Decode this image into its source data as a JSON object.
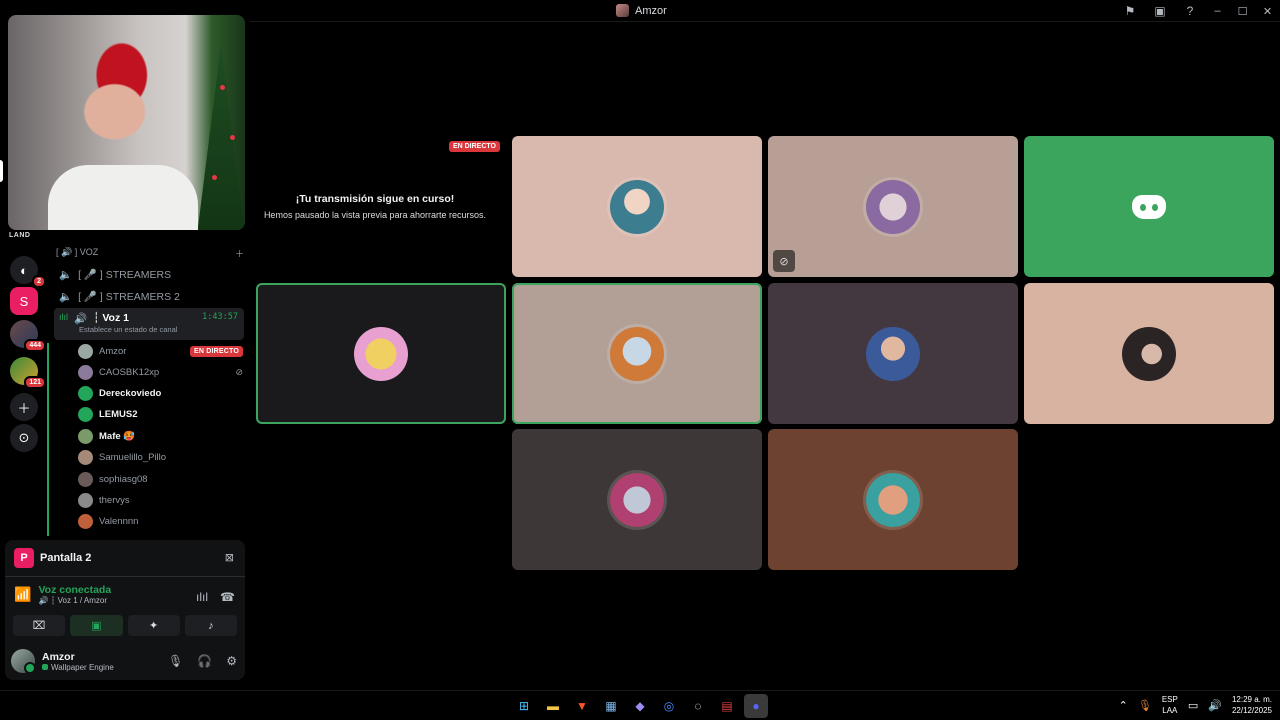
{
  "window": {
    "title": "Amzor",
    "controls": [
      "inbox-icon",
      "window-icon",
      "help-icon",
      "minimize-icon",
      "maximize-icon",
      "close-icon"
    ]
  },
  "rail": {
    "server_label": "LAND",
    "badges": [
      "2",
      "444",
      "121"
    ]
  },
  "sidebar": {
    "category": "[ 🔊 ] VOZ",
    "channels": [
      {
        "label": "[ 🎤 ] STREAMERS"
      },
      {
        "label": "[ 🎤 ] STREAMERS 2"
      }
    ],
    "active_channel": {
      "label": "┆ Voz 1",
      "time": "1:43:57",
      "status": "Establece un estado de canal"
    },
    "members": [
      {
        "name": "Amzor",
        "live": "EN DIRECTO",
        "color": "#9aa8a3"
      },
      {
        "name": "CAOSBK12xp",
        "muted": true,
        "color": "#8c7a9a"
      },
      {
        "name": "Dereckoviedo",
        "bright": true,
        "color": "#23a55a"
      },
      {
        "name": "LEMUS2",
        "bright": true,
        "color": "#23a55a"
      },
      {
        "name": "Mafe 🥵",
        "bright": true,
        "color": "#7a9a6a"
      },
      {
        "name": "Samuelillo_Pillo",
        "color": "#a58a7a"
      },
      {
        "name": "sophiasg08",
        "color": "#6a5a5a"
      },
      {
        "name": "thervys",
        "color": "#8a8a8a"
      },
      {
        "name": "Valennnn",
        "color": "#c0603a"
      }
    ]
  },
  "screen_panel": {
    "icon_letter": "P",
    "title": "Pantalla 2",
    "voice_status": "Voz conectada",
    "voice_location": "🔊 ┆ Voz 1 / Amzor"
  },
  "user": {
    "name": "Amzor",
    "status": "Wallpaper Engine"
  },
  "stream": {
    "live_badge": "EN DIRECTO",
    "title": "¡Tu transmisión sigue en curso!",
    "subtitle": "Hemos pausado la vista previa para ahorrarte recursos."
  },
  "tiles": [
    {
      "bg": "#d9b8ad",
      "avatar": "#3d7d90"
    },
    {
      "bg": "#b79f96",
      "avatar": "#8a6aa0",
      "muted": true
    },
    {
      "bg": "#3ba55d",
      "discord": true
    },
    {
      "bg": "#1a1a1d",
      "avatar": "#e8c24a",
      "speaking": true
    },
    {
      "bg": "#b2a096",
      "avatar": "#d07a3a",
      "speaking": true
    },
    {
      "bg": "#443840",
      "avatar": "#3a5a9a"
    },
    {
      "bg": "#d8b3a2",
      "avatar": "#2a2425"
    },
    {
      "bg": "#3e3738",
      "avatar": "#b04070"
    },
    {
      "bg": "#6e4230",
      "avatar": "#3aa0a0"
    }
  ],
  "taskbar": {
    "lang_top": "ESP",
    "lang_bottom": "LAA",
    "time": "12:29 a. m.",
    "date": "22/12/2025"
  }
}
